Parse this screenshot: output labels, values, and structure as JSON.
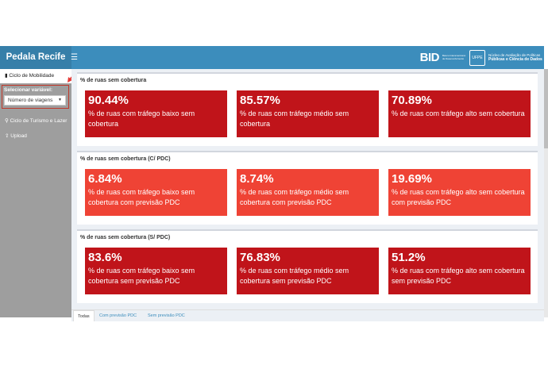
{
  "app_title": "Pedala Recife",
  "toggle_icon": "☰",
  "logos": {
    "bid": "BID",
    "bid_sub": "Banco Interamericano de Desenvolvimento",
    "uf_badge": "UFPE",
    "nucleo_line1": "Núcleo de Avaliação de Políticas",
    "nucleo_line2": "Públicas e Ciência de Dados"
  },
  "sidebar": {
    "active_item": "Ciclo de Mobilidade",
    "select_label": "Selecionar variável:",
    "select_value": "Número de viagens",
    "items": [
      "Ciclo de Turismo e Lazer",
      "Upload"
    ]
  },
  "sections": [
    {
      "title": "% de ruas sem cobertura",
      "variant": "dark",
      "boxes": [
        {
          "value": "90.44%",
          "label": "% de ruas com tráfego baixo sem cobertura"
        },
        {
          "value": "85.57%",
          "label": "% de ruas com tráfego médio sem cobertura"
        },
        {
          "value": "70.89%",
          "label": "% de ruas com tráfego alto sem cobertura"
        }
      ]
    },
    {
      "title": "% de ruas sem cobertura (C/ PDC)",
      "variant": "light",
      "boxes": [
        {
          "value": "6.84%",
          "label": "% de ruas com tráfego baixo sem cobertura com previsão PDC"
        },
        {
          "value": "8.74%",
          "label": "% de ruas com tráfego médio sem cobertura com previsão PDC"
        },
        {
          "value": "19.69%",
          "label": "% de ruas com tráfego alto sem cobertura com previsão PDC"
        }
      ]
    },
    {
      "title": "% de ruas sem cobertura (S/ PDC)",
      "variant": "dark",
      "boxes": [
        {
          "value": "83.6%",
          "label": "% de ruas com tráfego baixo sem cobertura sem previsão PDC"
        },
        {
          "value": "76.83%",
          "label": "% de ruas com tráfego médio sem cobertura sem previsão PDC"
        },
        {
          "value": "51.2%",
          "label": "% de ruas com tráfego alto sem cobertura sem previsão PDC"
        }
      ]
    }
  ],
  "tabs": [
    "Todas",
    "Com previsão PDC",
    "Sem previsão PDC"
  ],
  "colors": {
    "header": "#3c8dbc",
    "brand": "#367fa9",
    "dark_box": "#c0141a",
    "light_box": "#ef4335",
    "sidebar": "#9e9e9e"
  }
}
